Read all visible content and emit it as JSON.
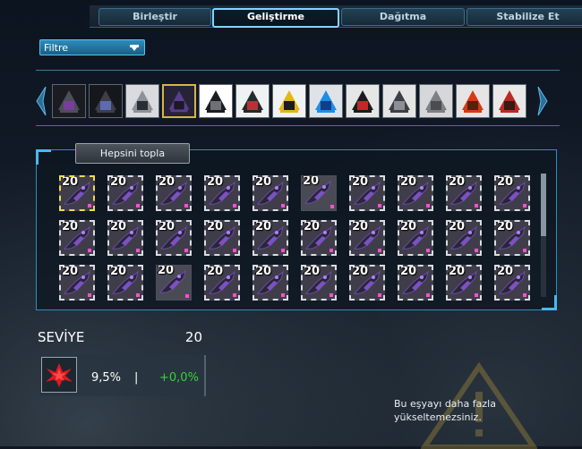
{
  "tabs": [
    {
      "label": "Birleştir",
      "active": false
    },
    {
      "label": "Geliştirme",
      "active": true
    },
    {
      "label": "Dağıtma",
      "active": false
    },
    {
      "label": "Stabilize Et",
      "active": false
    }
  ],
  "filter": {
    "label": "Filtre"
  },
  "carousel": {
    "items": [
      {
        "name": "dark-shotgun",
        "dark": true,
        "selected": false
      },
      {
        "name": "dark-rifle",
        "dark": true,
        "selected": false
      },
      {
        "name": "silver-rifle",
        "dark": false,
        "selected": false
      },
      {
        "name": "purple-creature-weapon",
        "dark": true,
        "selected": true
      },
      {
        "name": "panda-mech",
        "dark": false,
        "selected": false
      },
      {
        "name": "white-mech",
        "dark": false,
        "selected": false
      },
      {
        "name": "yellow-mech",
        "dark": false,
        "selected": false
      },
      {
        "name": "blue-robot",
        "dark": false,
        "selected": false
      },
      {
        "name": "red-black-mech",
        "dark": false,
        "selected": false
      },
      {
        "name": "grey-mech",
        "dark": false,
        "selected": false
      },
      {
        "name": "grey-vehicle",
        "dark": false,
        "selected": false
      },
      {
        "name": "red-lava-mech",
        "dark": false,
        "selected": false
      },
      {
        "name": "red-tower-mech",
        "dark": false,
        "selected": false
      }
    ]
  },
  "inventory": {
    "collect_all_label": "Hepsini topla",
    "slot_level": "20",
    "rows": 3,
    "cols": 10,
    "empty_slots": [
      [
        0,
        5
      ],
      [
        2,
        2
      ]
    ],
    "selected_slot": [
      0,
      0
    ]
  },
  "stats": {
    "level_label": "SEVİYE",
    "level_value": "20",
    "percent": "9,5%",
    "separator": "|",
    "gain": "+0,0%",
    "icon": "red-crystal-icon"
  },
  "notice": {
    "line1": "Bu eşyayı daha fazla",
    "line2": "yükseltemezsiniz."
  },
  "colors": {
    "accent": "#5ac3ef",
    "gain": "#35d339",
    "selected_border": "#d8b445"
  }
}
